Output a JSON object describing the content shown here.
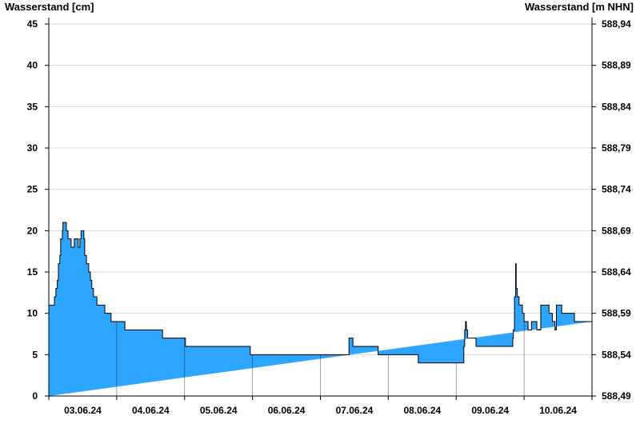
{
  "chart_data": {
    "type": "area",
    "ylabel_left": "Wasserstand [cm]",
    "ylabel_right": "Wasserstand [m NHN]",
    "ylim": [
      0,
      45
    ],
    "yticks": [
      0,
      5,
      10,
      15,
      20,
      25,
      30,
      35,
      40,
      45
    ],
    "yticks_right": [
      "588,49",
      "588,54",
      "588,59",
      "588,64",
      "588,69",
      "588,74",
      "588,79",
      "588,84",
      "588,89",
      "588,94"
    ],
    "x_days": [
      "03.06.24",
      "04.06.24",
      "05.06.24",
      "06.06.24",
      "07.06.24",
      "08.06.24",
      "09.06.24",
      "10.06.24"
    ],
    "xlim_hours": [
      0,
      192
    ],
    "grid": "horizontal",
    "fill_color": "#2ea6ff",
    "line_color": "#000000",
    "grid_color": "#d9d9d9",
    "series": [
      {
        "x_hours": [
          0,
          1.7,
          2.0,
          2.5,
          3.0,
          3.4,
          3.9,
          4.2,
          4.8,
          5.0,
          5.4,
          6.2,
          6.8,
          7.3,
          7.9,
          8.2,
          9.0,
          9.6,
          10.4,
          11.0,
          11.4,
          12.1,
          12.4,
          12.7,
          13.3,
          14.1,
          14.7,
          15.2,
          15.5,
          15.8,
          16.4,
          17.0,
          17.5,
          18.1,
          18.6,
          19.2,
          19.8,
          20.3,
          20.9,
          21.5,
          22.0,
          22.6,
          23.7,
          24.3,
          24.9,
          26.9,
          28.2,
          28.5,
          30.5,
          31.4,
          34.7,
          35.2,
          35.7,
          36.8,
          37.7,
          39.3,
          40.2,
          42.9,
          43.3,
          45.2,
          46.2,
          48.0,
          48.3,
          55.8,
          56.2,
          71.2,
          72.1,
          80.0,
          95.9,
          96.3,
          104.3,
          106.1,
          106.7,
          107.2,
          107.5,
          108.2,
          108.4,
          115.9,
          116.4,
          119.9,
          120.2,
          130.6,
          131.0,
          131.3,
          131.6,
          146.3,
          146.7,
          147.0,
          147.3,
          147.6,
          148.0,
          150.4,
          151.0,
          153.4,
          154.0,
          163.6,
          164.0,
          164.2,
          164.6,
          165.0,
          165.2,
          165.6,
          166.2,
          166.8,
          167.4,
          168.0,
          168.7,
          169.4,
          170.0,
          170.6,
          171.2,
          171.8,
          172.5,
          173.2,
          173.9,
          174.5,
          175.1,
          175.6,
          176.2,
          176.8,
          177.4,
          178.0,
          178.4,
          178.9,
          179.4,
          180.0,
          180.6,
          181.3,
          182.0,
          182.6,
          183.3,
          183.8,
          184.6,
          185.4,
          185.8,
          186.4,
          187.3,
          188.0,
          188.6,
          189.0,
          189.6,
          190.4,
          191.2,
          192.0
        ],
        "y_cm": [
          11,
          11,
          12,
          13,
          14,
          16,
          17,
          19,
          20,
          21,
          21,
          20,
          19,
          19,
          18,
          18,
          19,
          19,
          18,
          19,
          20,
          20,
          19,
          17,
          16,
          15,
          14,
          13,
          13,
          12,
          12,
          11,
          11,
          11,
          11,
          11,
          10,
          10,
          10,
          10,
          9,
          9,
          9,
          9,
          9,
          8,
          8,
          8,
          8,
          8,
          8,
          8,
          8,
          8,
          8,
          8,
          7,
          7,
          7,
          7,
          7,
          7,
          6,
          6,
          6,
          5,
          5,
          5,
          5,
          5,
          5,
          7,
          7,
          7,
          6,
          6,
          6,
          6,
          5,
          5,
          5,
          4,
          4,
          4,
          4,
          4,
          6,
          8,
          9,
          8,
          7,
          7,
          6,
          6,
          6,
          6,
          7,
          8,
          12,
          16,
          13,
          12,
          11,
          11,
          10,
          9,
          9,
          8,
          8,
          9,
          9,
          9,
          8,
          8,
          11,
          11,
          11,
          11,
          11,
          10,
          10,
          9,
          9,
          8,
          11,
          11,
          11,
          10,
          10,
          10,
          10,
          10,
          10,
          10,
          9,
          9,
          9,
          9,
          9,
          9,
          9,
          9,
          9
        ]
      }
    ]
  }
}
